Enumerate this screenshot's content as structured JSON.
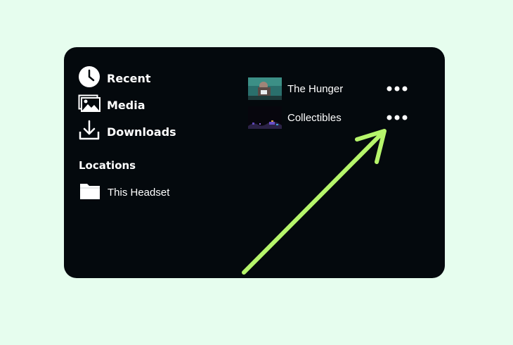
{
  "sidebar": {
    "items": [
      {
        "label": "Recent",
        "icon": "clock-icon"
      },
      {
        "label": "Media",
        "icon": "image-icon"
      },
      {
        "label": "Downloads",
        "icon": "download-icon"
      }
    ],
    "locations_title": "Locations",
    "locations": [
      {
        "label": "This Headset",
        "icon": "folder-icon"
      }
    ]
  },
  "files": [
    {
      "name": "The Hunger",
      "thumbnail": "video-thumbnail",
      "menu_icon": "more-options-icon"
    },
    {
      "name": "Collectibles",
      "thumbnail": "video-thumbnail",
      "menu_icon": "more-options-icon"
    }
  ],
  "colors": {
    "page_background": "#e6fdee",
    "panel_background": "#04090d",
    "text": "#ffffff",
    "annotation_arrow": "#b6f56b"
  }
}
